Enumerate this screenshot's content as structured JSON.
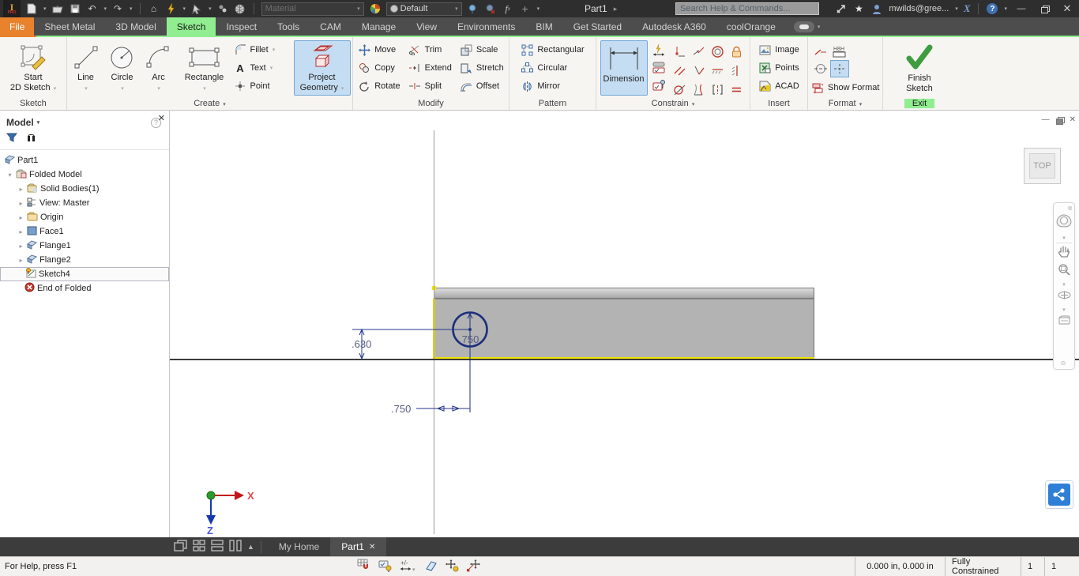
{
  "titlebar": {
    "logo_text": "PRO",
    "doc_title": "Part1",
    "search_placeholder": "Search Help & Commands...",
    "user_name": "mwilds@gree...",
    "material_value": "Material",
    "appearance_value": "Default"
  },
  "tabs": {
    "file": "File",
    "sheet_metal": "Sheet Metal",
    "model_3d": "3D Model",
    "sketch": "Sketch",
    "inspect": "Inspect",
    "tools": "Tools",
    "cam": "CAM",
    "manage": "Manage",
    "view": "View",
    "environments": "Environments",
    "bim": "BIM",
    "get_started": "Get Started",
    "a360": "Autodesk A360",
    "coolorange": "coolOrange"
  },
  "ribbon": {
    "sketch": {
      "label": "Sketch",
      "start_line1": "Start",
      "start_line2": "2D Sketch"
    },
    "create": {
      "label": "Create",
      "line": "Line",
      "circle": "Circle",
      "arc": "Arc",
      "rectangle": "Rectangle",
      "fillet": "Fillet",
      "text": "Text",
      "point": "Point",
      "project_line1": "Project",
      "project_line2": "Geometry"
    },
    "modify": {
      "label": "Modify",
      "move": "Move",
      "copy": "Copy",
      "rotate": "Rotate",
      "trim": "Trim",
      "extend": "Extend",
      "split": "Split",
      "scale": "Scale",
      "stretch": "Stretch",
      "offset": "Offset"
    },
    "pattern": {
      "label": "Pattern",
      "rectangular": "Rectangular",
      "circular": "Circular",
      "mirror": "Mirror"
    },
    "constrain": {
      "label": "Constrain",
      "dimension": "Dimension"
    },
    "insert": {
      "label": "Insert",
      "image": "Image",
      "points": "Points",
      "acad": "ACAD"
    },
    "format": {
      "label": "Format",
      "show_format": "Show Format"
    },
    "exit": {
      "label": "Exit",
      "finish_line1": "Finish",
      "finish_line2": "Sketch"
    }
  },
  "browser": {
    "header": "Model",
    "tree": [
      {
        "label": "Part1"
      },
      {
        "label": "Folded Model"
      },
      {
        "label": "Solid Bodies(1)"
      },
      {
        "label": "View: Master"
      },
      {
        "label": "Origin"
      },
      {
        "label": "Face1"
      },
      {
        "label": "Flange1"
      },
      {
        "label": "Flange2"
      },
      {
        "label": "Sketch4"
      },
      {
        "label": "End of Folded"
      }
    ]
  },
  "canvas": {
    "viewcube_face": "TOP",
    "dimensions": {
      "circle_diameter": ".750",
      "vertical_offset": ".630",
      "horizontal_offset": ".750"
    },
    "triad": {
      "x_label": "X",
      "z_label": "Z"
    }
  },
  "doctabs": {
    "my_home": "My Home",
    "part1": "Part1"
  },
  "statusbar": {
    "help_text": "For Help, press F1",
    "coordinates": "0.000 in, 0.000 in",
    "constraint_status": "Fully Constrained",
    "count1": "1",
    "count2": "1"
  },
  "colors": {
    "tab_active_green": "#90ee90",
    "file_tab_orange": "#e8822d",
    "tool_active_blue": "#c5ddf2",
    "sketch_navy": "#1c2f7c",
    "highlight_yellow": "#f0e400",
    "part_gray": "#b3b3b3"
  }
}
